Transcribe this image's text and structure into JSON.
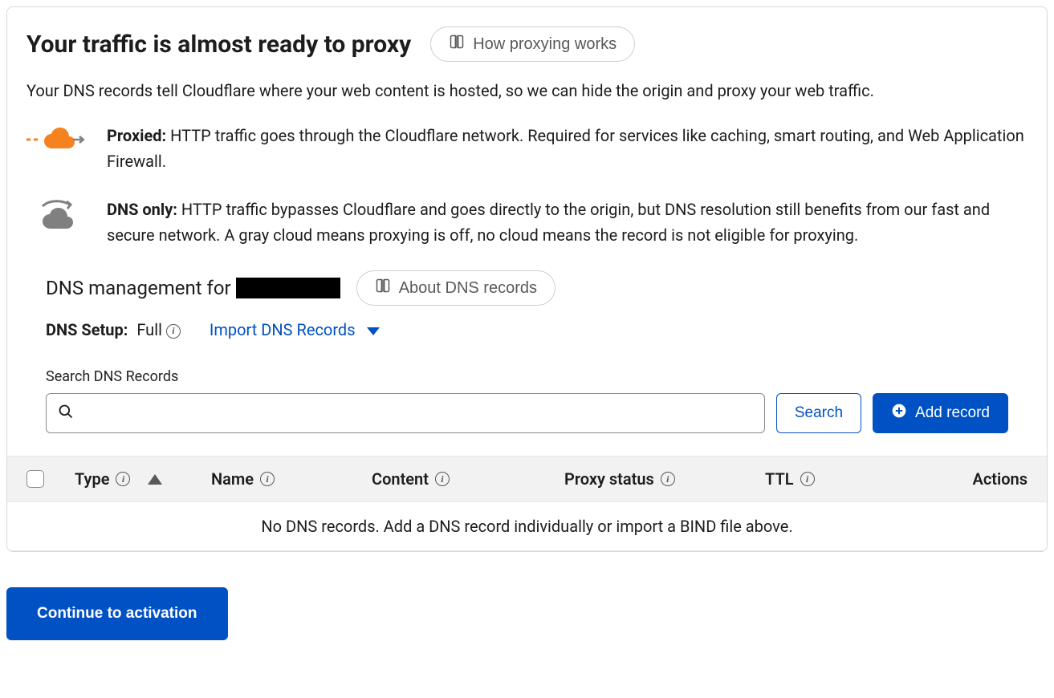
{
  "header": {
    "title": "Your traffic is almost ready to proxy",
    "how_proxy_btn": "How proxying works"
  },
  "lead": "Your DNS records tell Cloudflare where your web content is hosted, so we can hide the origin and proxy your web traffic.",
  "definitions": {
    "proxied": {
      "label": "Proxied:",
      "text": "HTTP traffic goes through the Cloudflare network. Required for services like caching, smart routing, and Web Application Firewall."
    },
    "dns_only": {
      "label": "DNS only:",
      "text": "HTTP traffic bypasses Cloudflare and goes directly to the origin, but DNS resolution still benefits from our fast and secure network. A gray cloud means proxying is off, no cloud means the record is not eligible for proxying."
    }
  },
  "management": {
    "title_prefix": "DNS management for ",
    "about_btn": "About DNS records"
  },
  "setup": {
    "label": "DNS Setup:",
    "value": "Full",
    "import_link": "Import DNS Records"
  },
  "search": {
    "label": "Search DNS Records",
    "placeholder": "",
    "search_btn": "Search",
    "add_btn": "Add record"
  },
  "table": {
    "headers": {
      "type": "Type",
      "name": "Name",
      "content": "Content",
      "proxy": "Proxy status",
      "ttl": "TTL",
      "actions": "Actions"
    },
    "empty": "No DNS records. Add a DNS record individually or import a BIND file above."
  },
  "cta": "Continue to activation",
  "icons": {
    "info": "i"
  }
}
